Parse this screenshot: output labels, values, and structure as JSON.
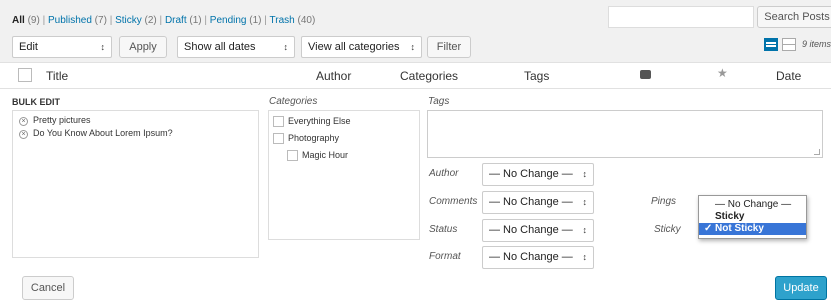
{
  "filters": {
    "all": "All",
    "all_count": "(9)",
    "published": "Published",
    "published_count": "(7)",
    "sticky": "Sticky",
    "sticky_count": "(2)",
    "draft": "Draft",
    "draft_count": "(1)",
    "pending": "Pending",
    "pending_count": "(1)",
    "trash": "Trash",
    "trash_count": "(40)"
  },
  "search_button": "Search Posts",
  "items_count": "9 items",
  "toolbar": {
    "bulk_action": "Edit",
    "apply": "Apply",
    "dates": "Show all dates",
    "categories": "View all categories",
    "filter": "Filter"
  },
  "columns": {
    "title": "Title",
    "author": "Author",
    "categories": "Categories",
    "tags": "Tags",
    "date": "Date"
  },
  "bulk_edit": {
    "heading": "BULK EDIT",
    "posts": [
      "Pretty pictures",
      "Do You Know About Lorem Ipsum?"
    ],
    "categories_label": "Categories",
    "categories": [
      "Everything Else",
      "Photography",
      "Magic Hour"
    ],
    "tags_label": "Tags",
    "author_label": "Author",
    "author_value": "— No Change —",
    "comments_label": "Comments",
    "comments_value": "— No Change —",
    "status_label": "Status",
    "status_value": "— No Change —",
    "format_label": "Format",
    "format_value": "— No Change —",
    "pings_label": "Pings",
    "sticky_label": "Sticky",
    "sticky_options": [
      "— No Change —",
      "Sticky",
      "Not Sticky"
    ],
    "cancel": "Cancel",
    "update": "Update"
  }
}
